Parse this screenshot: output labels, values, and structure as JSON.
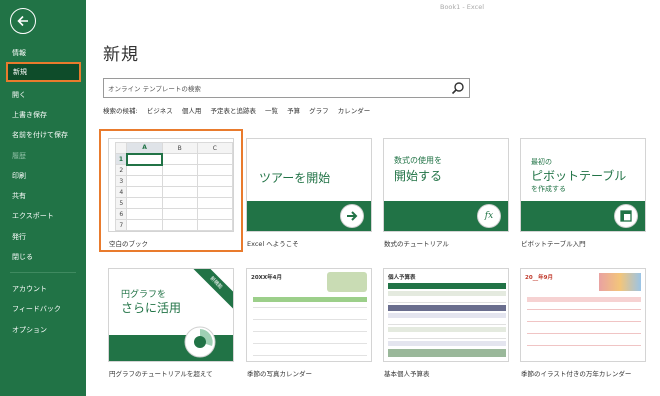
{
  "window": {
    "title": "Book1  -  Excel"
  },
  "sidebar": {
    "items": [
      {
        "label": "情報"
      },
      {
        "label": "新規"
      },
      {
        "label": "開く"
      },
      {
        "label": "上書き保存"
      },
      {
        "label": "名前を付けて保存"
      },
      {
        "label": "履歴"
      },
      {
        "label": "印刷"
      },
      {
        "label": "共有"
      },
      {
        "label": "エクスポート"
      },
      {
        "label": "発行"
      },
      {
        "label": "閉じる"
      },
      {
        "label": "アカウント"
      },
      {
        "label": "フィードバック"
      },
      {
        "label": "オプション"
      }
    ],
    "selected_index": 1
  },
  "main": {
    "title": "新規",
    "search": {
      "placeholder": "オンライン テンプレートの検索"
    },
    "suggestions": {
      "label": "検索の候補:",
      "items": [
        "ビジネス",
        "個人用",
        "予定表と追跡表",
        "一覧",
        "予算",
        "グラフ",
        "カレンダー"
      ]
    },
    "templates": [
      {
        "label": "空白のブック",
        "grid_cols": [
          "A",
          "B",
          "C"
        ],
        "grid_rows": [
          "1",
          "2",
          "3",
          "4",
          "5",
          "6",
          "7"
        ]
      },
      {
        "label": "Excel へようこそ",
        "tile_text": "ツアーを開始"
      },
      {
        "label": "数式のチュートリアル",
        "tile_line1": "数式の使用を",
        "tile_line2": "開始する",
        "fx": "fx"
      },
      {
        "label": "ピボットテーブル入門",
        "tile_line1": "最初の",
        "tile_line2": "ピボットテーブル",
        "tile_line3": "を作成する"
      },
      {
        "label": "円グラフのチュートリアルを超えて",
        "tile_line1": "円グラフを",
        "tile_line2": "さらに活用",
        "ribbon": "新機能"
      },
      {
        "label": "季節の写真カレンダー",
        "tile_text": "20XX年4月"
      },
      {
        "label": "基本個人予算表",
        "tile_text": "個人予算表"
      },
      {
        "label": "季節のイラスト付きの万年カレンダー",
        "tile_text": "20__年9月"
      }
    ]
  },
  "colors": {
    "accent": "#217346",
    "highlight": "#e97b2d"
  }
}
